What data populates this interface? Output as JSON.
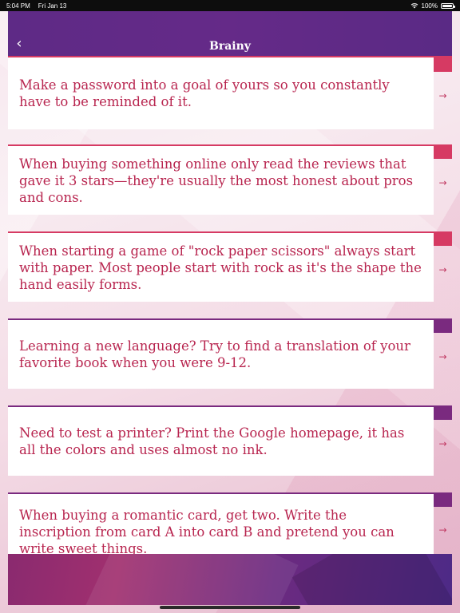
{
  "status_bar": {
    "time": "5:04 PM",
    "date": "Fri Jan 13",
    "battery": "100%",
    "battery_level": 1.0
  },
  "nav": {
    "back_icon": "chevron-left-icon",
    "back_glyph": "‹",
    "title": "Brainy"
  },
  "tips": [
    {
      "text": "Make a password into a goal of yours so you constantly have to be reminded of it."
    },
    {
      "text": "When buying something online only read the reviews that gave it 3 stars—they're usually the most honest about pros and cons."
    },
    {
      "text": "When starting a game of \"rock paper scissors\" always start with paper. Most people start with rock as it's the shape the hand easily forms."
    },
    {
      "text": "Learning a new language? Try to find a translation of your favorite book when you were 9-12."
    },
    {
      "text": "Need to test a printer? Print the Google homepage, it has all the colors and uses almost no ink."
    },
    {
      "text": "When buying a romantic card, get two. Write the inscription from card A into card B and pretend you can write sweet things."
    }
  ],
  "row_chevron": "→",
  "colors": {
    "nav_purple": "#652a88",
    "accent_red": "#d63a63",
    "accent_purple": "#7a2a7f",
    "tip_text": "#b8254f"
  }
}
